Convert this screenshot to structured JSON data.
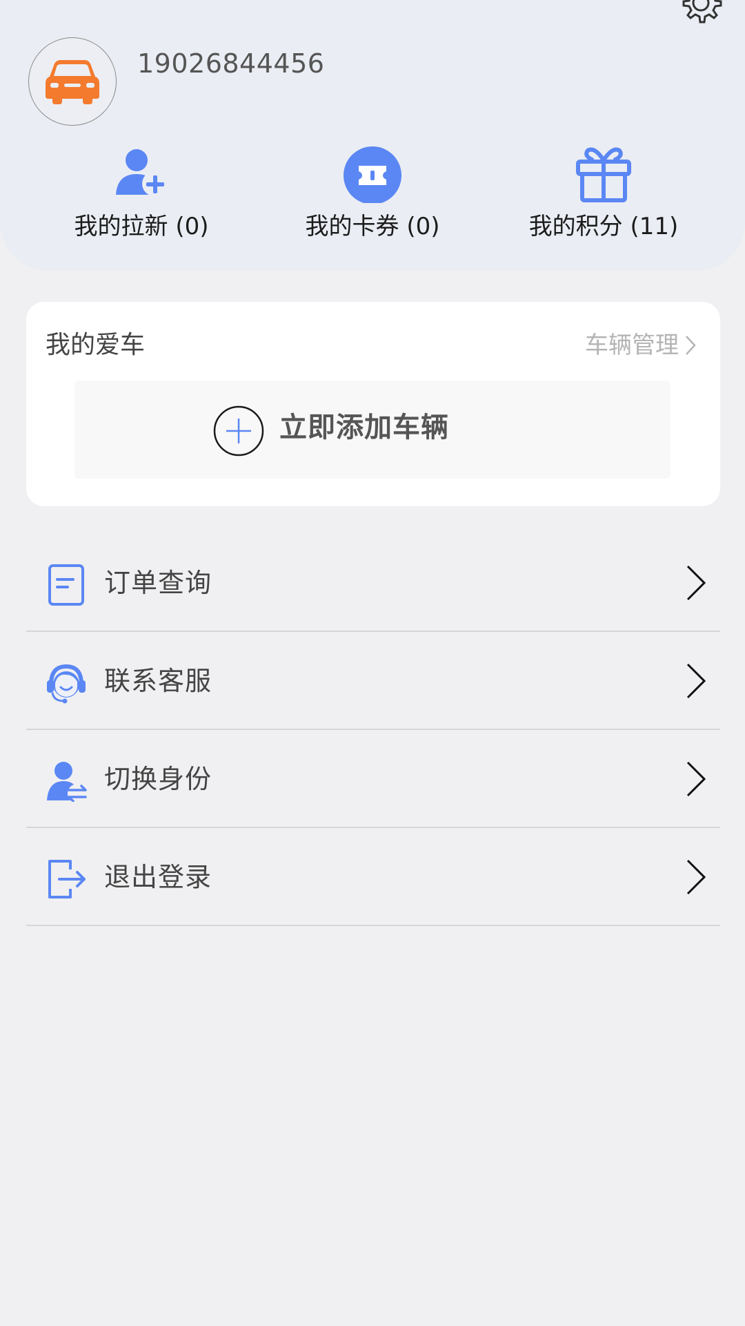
{
  "header": {
    "phone": "19026844456",
    "stats": [
      {
        "label": "我的拉新 (0)",
        "icon": "add-user-icon"
      },
      {
        "label": "我的卡券 (0)",
        "icon": "ticket-icon"
      },
      {
        "label": "我的积分 (11)",
        "icon": "gift-icon"
      }
    ]
  },
  "car_card": {
    "title": "我的爱车",
    "manage_link": "车辆管理",
    "add_label": "立即添加车辆"
  },
  "menu": [
    {
      "label": "订单查询",
      "icon": "order-document-icon"
    },
    {
      "label": "联系客服",
      "icon": "customer-service-icon"
    },
    {
      "label": "切换身份",
      "icon": "switch-identity-icon"
    },
    {
      "label": "退出登录",
      "icon": "logout-icon"
    }
  ],
  "colors": {
    "accent": "#5b87f4",
    "avatar_car": "#f47a2e",
    "header_bg": "#eaedf3",
    "page_bg": "#f0f0f2"
  }
}
